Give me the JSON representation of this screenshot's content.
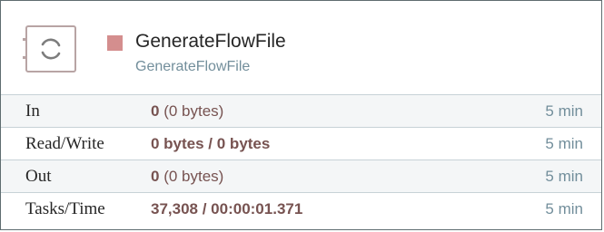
{
  "processor": {
    "icon": "processor-icon",
    "status_icon": "stopped-status-icon",
    "status_color": "#d48e8e",
    "name": "GenerateFlowFile",
    "type": "GenerateFlowFile"
  },
  "stats": [
    {
      "label": "In",
      "value_bold": "0",
      "value_plain": " (0 bytes)",
      "time": "5 min"
    },
    {
      "label": "Read/Write",
      "value_bold": "0 bytes / 0 bytes",
      "value_plain": "",
      "time": "5 min"
    },
    {
      "label": "Out",
      "value_bold": "0",
      "value_plain": " (0 bytes)",
      "time": "5 min"
    },
    {
      "label": "Tasks/Time",
      "value_bold": "37,308 / 00:00:01.371",
      "value_plain": "",
      "time": "5 min"
    }
  ]
}
